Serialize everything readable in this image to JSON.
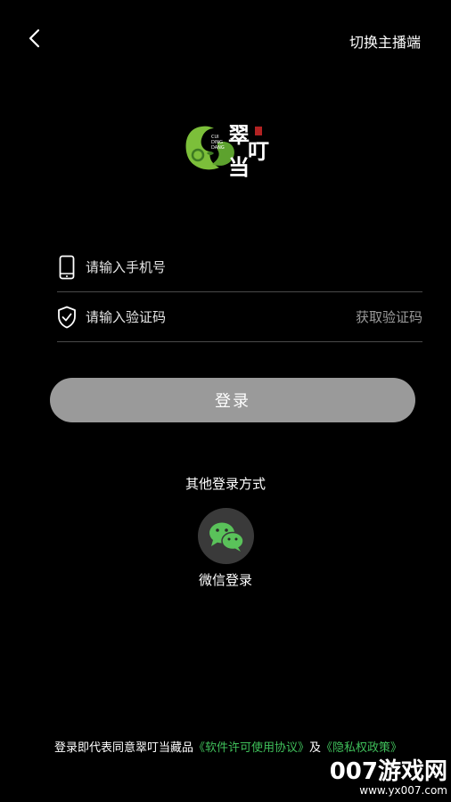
{
  "header": {
    "back_icon": "chevron-left-icon",
    "switch_label": "切换主播端"
  },
  "logo": {
    "text_main": "翠叮当",
    "text_sub": "CUI DING DANG",
    "colors": {
      "green": "#7cbf3a",
      "dark_green": "#3d7a22"
    }
  },
  "form": {
    "phone": {
      "icon": "phone-icon",
      "placeholder": "请输入手机号",
      "value": ""
    },
    "code": {
      "icon": "shield-check-icon",
      "placeholder": "请输入验证码",
      "value": "",
      "get_code_label": "获取验证码"
    },
    "login_label": "登录"
  },
  "other_login": {
    "title": "其他登录方式",
    "wechat_icon": "wechat-icon",
    "wechat_label": "微信登录"
  },
  "agreement": {
    "prefix": "登录即代表同意翠叮当藏品",
    "software_link": "《软件许可使用协议》",
    "and": "及",
    "privacy_link": "《隐私权政策》"
  },
  "watermark": {
    "brand": "007游戏网",
    "url": "www.yx007.com"
  },
  "colors": {
    "background": "#000000",
    "button_disabled": "#9a9a9a",
    "link_green": "#3fbf5a",
    "wechat_green": "#5ac25a"
  }
}
